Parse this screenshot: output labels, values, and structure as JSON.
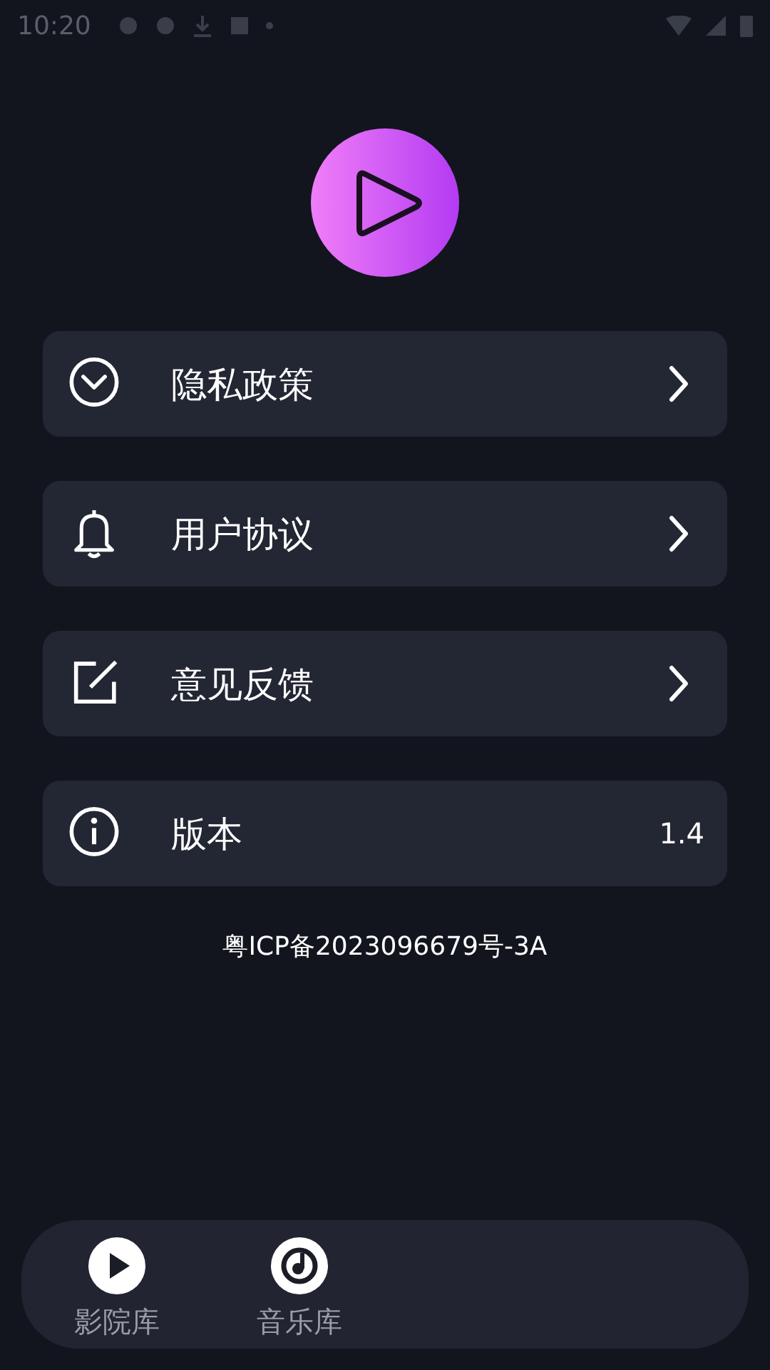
{
  "status_bar": {
    "time": "10:20"
  },
  "menu": [
    {
      "kind": "privacy",
      "label": "隐私政策"
    },
    {
      "kind": "agreement",
      "label": "用户协议"
    },
    {
      "kind": "feedback",
      "label": "意见反馈"
    },
    {
      "kind": "version",
      "label": "版本",
      "value": "1.4"
    }
  ],
  "footer": {
    "icp": "粤ICP备2023096679号-3A"
  },
  "bottom_nav": [
    {
      "kind": "cinema",
      "label": "影院库",
      "selected": false
    },
    {
      "kind": "music",
      "label": "音乐库",
      "selected": false
    }
  ]
}
